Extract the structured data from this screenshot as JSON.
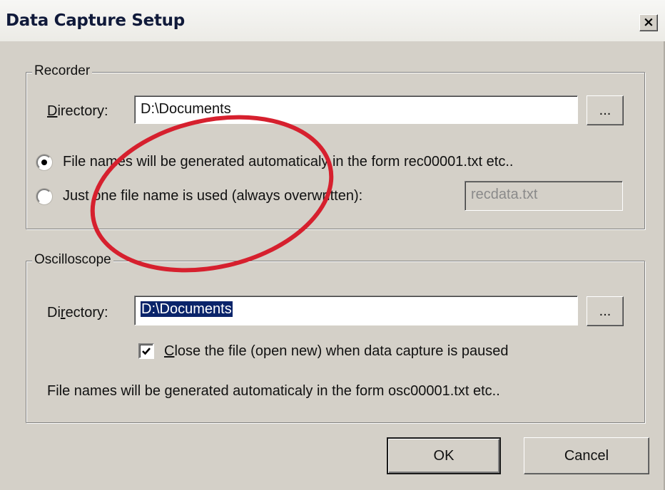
{
  "window": {
    "title": "Data Capture Setup",
    "close_glyph": "×"
  },
  "recorder": {
    "group_label": "Recorder",
    "directory_label_prefix": "",
    "directory_label_mnemonic": "D",
    "directory_label_rest": "irectory:",
    "directory_value": "D:\\Documents",
    "browse_label": "...",
    "radio_auto_label": "File names will be generated automaticaly in the form rec00001.txt etc..",
    "radio_auto_selected": true,
    "radio_single_label": "Just one file name is used (always overwritten):",
    "radio_single_selected": false,
    "single_filename_value": "recdata.txt"
  },
  "oscilloscope": {
    "group_label": "Oscilloscope",
    "directory_label_prefix": "Di",
    "directory_label_mnemonic": "r",
    "directory_label_rest": "ectory:",
    "directory_value": "D:\\Documents",
    "browse_label": "...",
    "close_file_mnemonic": "C",
    "close_file_rest": "lose the file (open new) when data capture is paused",
    "close_file_checked": true,
    "info_text": "File names will be generated automaticaly in the form osc00001.txt etc.."
  },
  "buttons": {
    "ok_label": "OK",
    "cancel_label": "Cancel"
  },
  "annotation": {
    "ellipse_color": "#d6202e"
  }
}
